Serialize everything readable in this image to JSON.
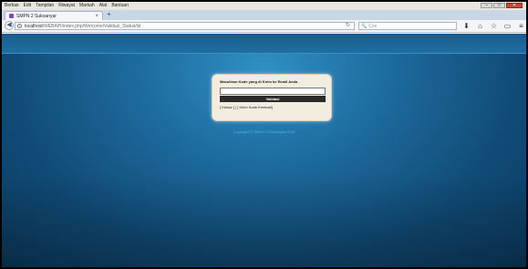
{
  "menubar": {
    "items": [
      "Berkas",
      "Edit",
      "Tampilan",
      "Riwayat",
      "Markah",
      "Alat",
      "Bantuan"
    ],
    "minimize": "–",
    "maximize": "□",
    "close": "✕"
  },
  "tab": {
    "title": "SMPN 2 Sukoanyar",
    "close": "×",
    "new_tab": "+"
  },
  "navbar": {
    "url_host": "localhost",
    "url_path": "/WEBAPI/index.php/Welcome/Validasi_Status/lst",
    "search_placeholder": "Cari"
  },
  "card": {
    "title": "Masukkan Kode yang di Kirim ke Email Anda",
    "input_value": "",
    "button": "Validasi",
    "links": "[ Keluar ] | [ Kirim Kode Kembali]"
  },
  "footer": {
    "copyright": "Copyright © SMPN 2 Sukoanyar 2019"
  },
  "colors": {
    "accent": "#45b4e6",
    "background": "#1d6a9d",
    "button": "#2b2b2b"
  }
}
